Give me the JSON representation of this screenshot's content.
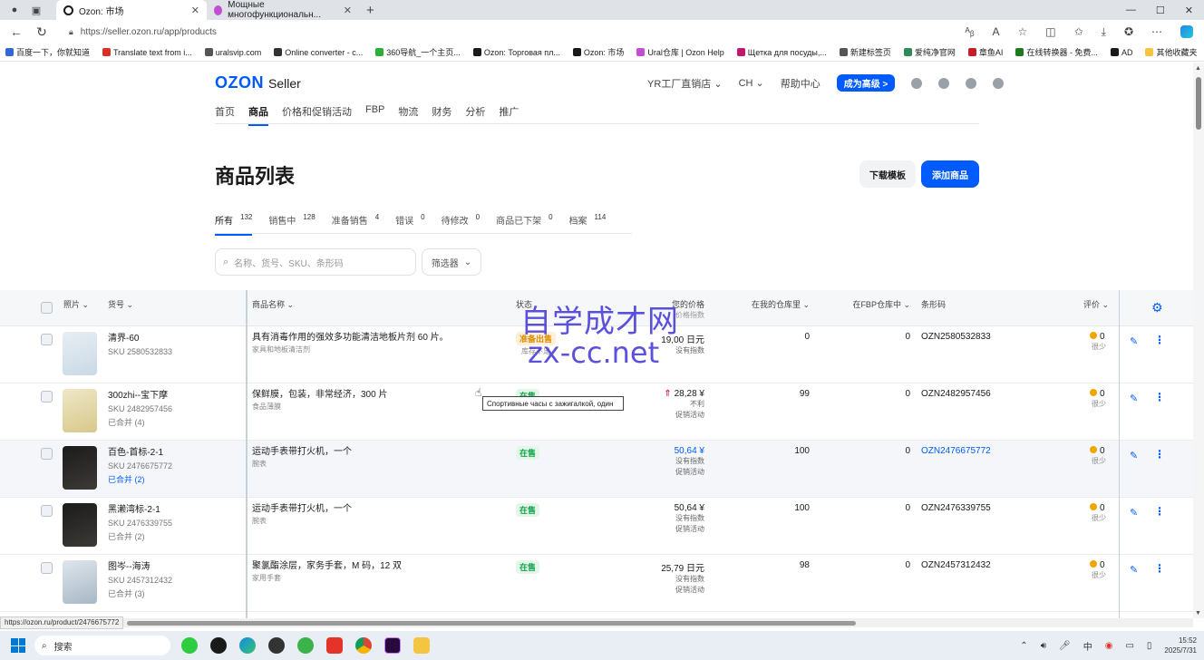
{
  "browser": {
    "tabs": [
      {
        "title": "Ozon: 市场",
        "active": true,
        "favicon_color": "#1a1a1a"
      },
      {
        "title": "Мощные многофункциональн...",
        "active": false,
        "favicon_color": "#c24fd1"
      }
    ],
    "new_tab": "+",
    "url": "https://seller.ozon.ru/app/products",
    "window_controls": [
      "—",
      "☐",
      "✕"
    ],
    "bookmarks": [
      {
        "label": "百度一下，你就知道",
        "color": "#3367d6"
      },
      {
        "label": "Translate text from i...",
        "color": "#d93025"
      },
      {
        "label": "uralsvip.com",
        "color": "#555555"
      },
      {
        "label": "Online converter - c...",
        "color": "#333333"
      },
      {
        "label": "360导航_一个主页...",
        "color": "#2cae3a"
      },
      {
        "label": "Ozon: Торговая пл...",
        "color": "#1a1a1a"
      },
      {
        "label": "Ozon: 市场",
        "color": "#1a1a1a"
      },
      {
        "label": "Ural仓库 | Ozon Help",
        "color": "#c24fd1"
      },
      {
        "label": "Щетка для посуды,...",
        "color": "#c0186c"
      },
      {
        "label": "新建标签页",
        "color": "#555555"
      },
      {
        "label": "爱纯净官网",
        "color": "#2e8b57"
      },
      {
        "label": "章鱼AI",
        "color": "#c81d25"
      },
      {
        "label": "在线转换器 - 免费...",
        "color": "#1f7a1f"
      },
      {
        "label": "AD",
        "color": "#1a1a1a"
      }
    ],
    "other_favorites": "其他收藏夹"
  },
  "header": {
    "logo": "OZON",
    "logo_sub": "Seller",
    "store": "YR工厂直销店",
    "lang": "CH",
    "help": "帮助中心",
    "upgrade": "成为高级 >"
  },
  "nav": [
    "首页",
    "商品",
    "价格和促销活动",
    "FBP",
    "物流",
    "财务",
    "分析",
    "推广"
  ],
  "page": {
    "title": "商品列表",
    "download": "下载模板",
    "add": "添加商品"
  },
  "filter_tabs": [
    {
      "label": "所有",
      "count": "132",
      "active": true
    },
    {
      "label": "销售中",
      "count": "128"
    },
    {
      "label": "准备销售",
      "count": "4"
    },
    {
      "label": "错误",
      "count": "0"
    },
    {
      "label": "待修改",
      "count": "0"
    },
    {
      "label": "商品已下架",
      "count": "0"
    },
    {
      "label": "档案",
      "count": "114"
    }
  ],
  "search": {
    "placeholder": "名称、货号、SKU、条形码"
  },
  "filter_button": "筛选器",
  "columns": {
    "photo": "照片",
    "article": "货号",
    "name": "商品名称",
    "status": "状态",
    "price": "您的价格",
    "price_sub": "价格指数",
    "my_stock": "在我的仓库里",
    "fbp_stock": "在FBP仓库中",
    "barcode": "条形码",
    "rating": "评价"
  },
  "rows": [
    {
      "article": "清界-60",
      "sku": "SKU 2580532833",
      "merged": "",
      "name": "具有消毒作用的强效多功能清洁地板片剂 60 片。",
      "category": "家具和地板清洁剂",
      "name_link": false,
      "status": "准备出售",
      "status_sub": "库存不足",
      "status_type": "orange",
      "price": "19,00 日元",
      "price_up": false,
      "price_link": false,
      "price_lines": [
        "没有指数"
      ],
      "my_stock": "0",
      "fbp_stock": "0",
      "barcode": "OZN2580532833",
      "barcode_link": false,
      "rating": "0",
      "rating_sub": "很少",
      "image_colors": [
        "#e8eef3",
        "#c9d9e6"
      ]
    },
    {
      "article": "300zhi--宝下摩",
      "sku": "SKU 2482957456",
      "merged": "已合并 (4)",
      "name": "保鲜膜，包装，非常经济，300 片",
      "category": "食品薄膜",
      "name_link": false,
      "status": "在售",
      "status_sub": "",
      "status_type": "green",
      "price": "28,28 ¥",
      "price_up": true,
      "price_link": false,
      "price_lines": [
        "不利",
        "促销活动"
      ],
      "my_stock": "99",
      "fbp_stock": "0",
      "barcode": "OZN2482957456",
      "barcode_link": false,
      "rating": "0",
      "rating_sub": "很少",
      "image_colors": [
        "#efe7c8",
        "#d7c88a"
      ]
    },
    {
      "article": "百色-首标-2-1",
      "sku": "SKU 2476675772",
      "merged": "已合并 (2)",
      "name": "运动手表带打火机，一个",
      "category": "腕表",
      "name_link": true,
      "status": "在售",
      "status_sub": "",
      "status_type": "green",
      "price": "50,64 ¥",
      "price_up": false,
      "price_link": true,
      "price_lines": [
        "没有指数",
        "促销活动"
      ],
      "my_stock": "100",
      "fbp_stock": "0",
      "barcode": "OZN2476675772",
      "barcode_link": true,
      "rating": "0",
      "rating_sub": "很少",
      "image_colors": [
        "#1b1b1b",
        "#3d3a36"
      ]
    },
    {
      "article": "黑濑湾标-2-1",
      "sku": "SKU 2476339755",
      "merged": "已合并 (2)",
      "name": "运动手表带打火机，一个",
      "category": "腕表",
      "name_link": false,
      "status": "在售",
      "status_sub": "",
      "status_type": "green",
      "price": "50,64 ¥",
      "price_up": false,
      "price_link": false,
      "price_lines": [
        "没有指数",
        "促销活动"
      ],
      "my_stock": "100",
      "fbp_stock": "0",
      "barcode": "OZN2476339755",
      "barcode_link": false,
      "rating": "0",
      "rating_sub": "很少",
      "image_colors": [
        "#1b1b1b",
        "#3d3a36"
      ]
    },
    {
      "article": "图岑--海涛",
      "sku": "SKU 2457312432",
      "merged": "已合并 (3)",
      "name": "聚氯酯涂层，家务手套，M 码，12 双",
      "category": "家用手套",
      "name_link": false,
      "status": "在售",
      "status_sub": "",
      "status_type": "green",
      "price": "25,79 日元",
      "price_up": false,
      "price_link": false,
      "price_lines": [
        "没有指数",
        "促销活动"
      ],
      "my_stock": "98",
      "fbp_stock": "0",
      "barcode": "OZN2457312432",
      "barcode_link": false,
      "rating": "0",
      "rating_sub": "很少",
      "image_colors": [
        "#dfe6ec",
        "#a7b7c6"
      ]
    }
  ],
  "tooltip": "Спортивные часы с зажигалкой, один",
  "watermark": {
    "line1": "自学成才网",
    "line2": "zx-cc.net"
  },
  "status_url": "https://ozon.ru/product/2476675772",
  "taskbar": {
    "search": "搜索",
    "time": "15:52",
    "date": "2025/7/31",
    "ime": "中"
  },
  "colors": {
    "accent": "#005bff",
    "success": "#10a44b",
    "warning": "#e08a00"
  }
}
